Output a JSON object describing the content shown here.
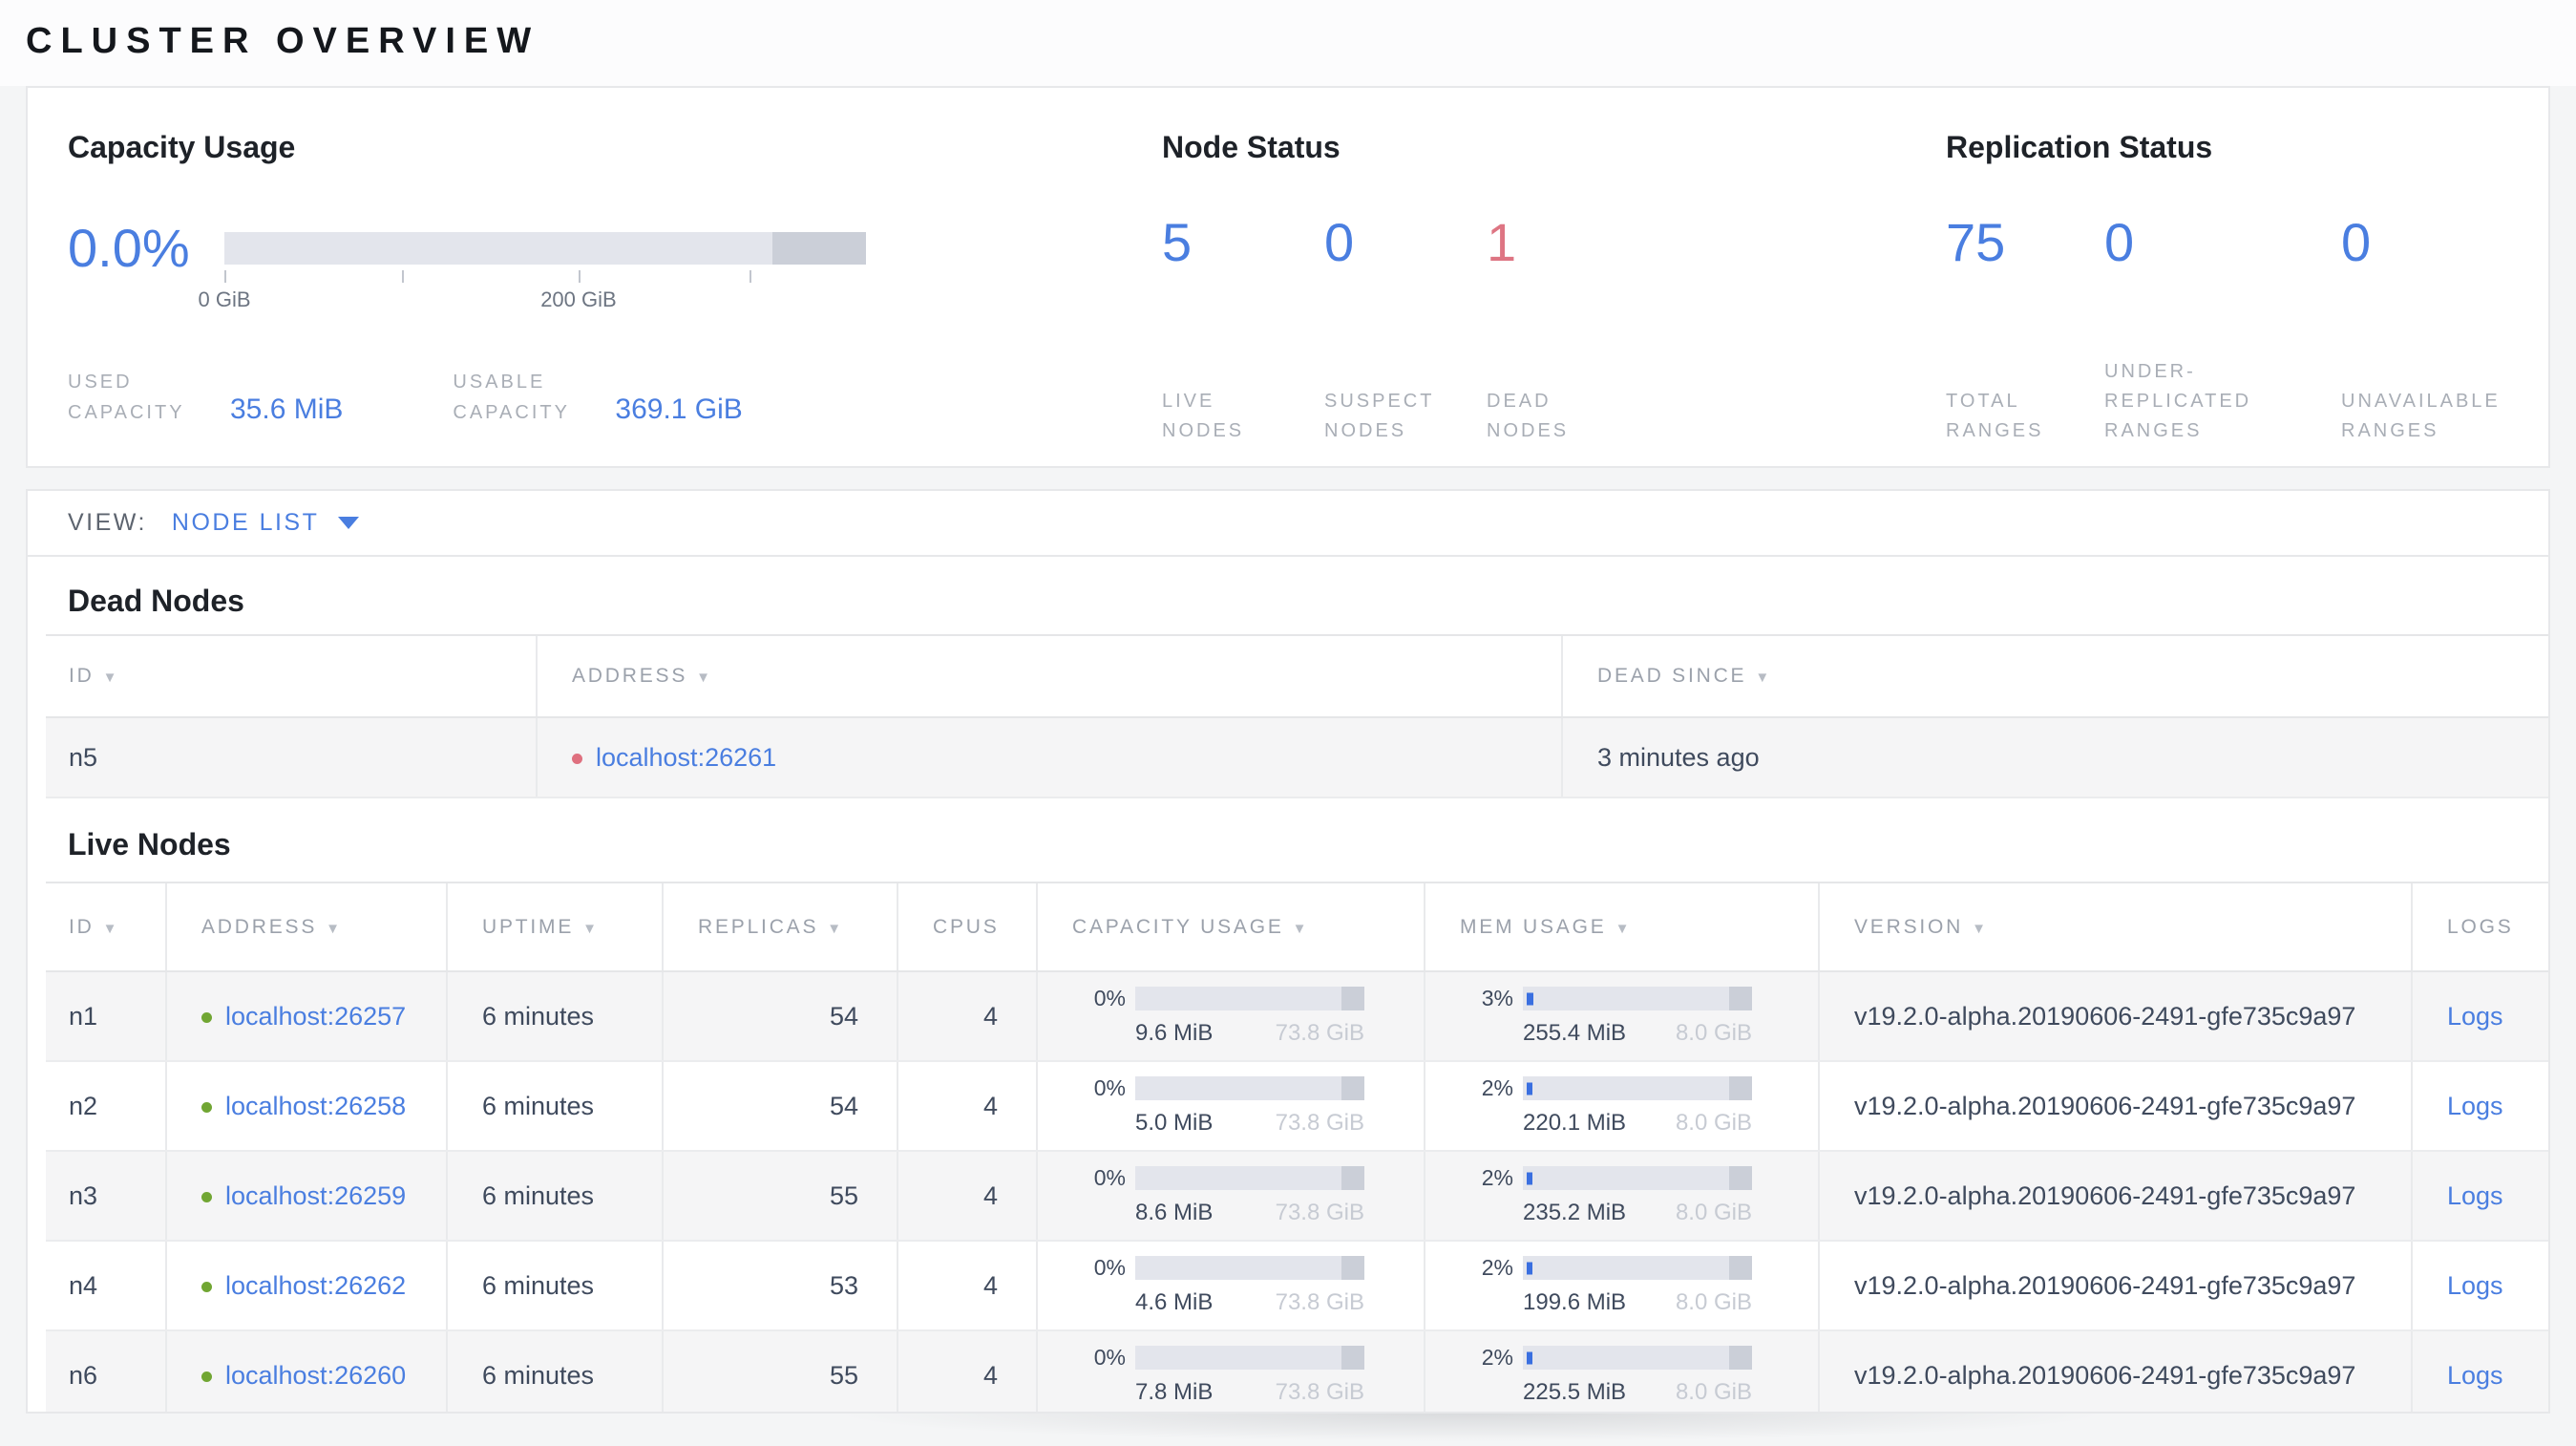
{
  "page_title": "CLUSTER OVERVIEW",
  "colors": {
    "accent_blue": "#4a7ee0",
    "danger_red": "#de7583",
    "live_dot": "#71a633",
    "dead_dot": "#df707f",
    "bar_track": "#e3e5ec",
    "bar_dark": "#cbcfd8"
  },
  "summary": {
    "capacity": {
      "title": "Capacity Usage",
      "percent": "0.0%",
      "tick_labels": {
        "start": "0 GiB",
        "mid": "200 GiB"
      },
      "metrics": [
        {
          "label": "USED CAPACITY",
          "value": "35.6 MiB"
        },
        {
          "label": "USABLE CAPACITY",
          "value": "369.1 GiB"
        }
      ]
    },
    "node_status": {
      "title": "Node Status",
      "stats": [
        {
          "value": "5",
          "label": "LIVE NODES",
          "state": "live"
        },
        {
          "value": "0",
          "label": "SUSPECT NODES",
          "state": "suspect"
        },
        {
          "value": "1",
          "label": "DEAD NODES",
          "state": "dead"
        }
      ]
    },
    "replication_status": {
      "title": "Replication Status",
      "stats": [
        {
          "value": "75",
          "label": "TOTAL RANGES",
          "state": "normal"
        },
        {
          "value": "0",
          "label": "UNDER-REPLICATED RANGES",
          "state": "normal"
        },
        {
          "value": "0",
          "label": "UNAVAILABLE RANGES",
          "state": "normal"
        }
      ]
    }
  },
  "view_bar": {
    "label": "VIEW:",
    "selected": "NODE LIST"
  },
  "dead_nodes": {
    "title": "Dead Nodes",
    "columns": [
      {
        "key": "id",
        "label": "ID",
        "sort": true
      },
      {
        "key": "address",
        "label": "ADDRESS",
        "sort": true
      },
      {
        "key": "dead_since",
        "label": "DEAD SINCE",
        "sort": true
      }
    ],
    "rows": [
      {
        "id": "n5",
        "address": "localhost:26261",
        "status": "dead",
        "dead_since": "3 minutes ago"
      }
    ]
  },
  "live_nodes": {
    "title": "Live Nodes",
    "columns": [
      {
        "key": "id",
        "label": "ID",
        "sort": true
      },
      {
        "key": "address",
        "label": "ADDRESS",
        "sort": true
      },
      {
        "key": "uptime",
        "label": "UPTIME",
        "sort": true
      },
      {
        "key": "replicas",
        "label": "REPLICAS",
        "sort": true
      },
      {
        "key": "cpus",
        "label": "CPUS",
        "sort": false
      },
      {
        "key": "capacity",
        "label": "CAPACITY USAGE",
        "sort": true
      },
      {
        "key": "mem",
        "label": "MEM USAGE",
        "sort": true
      },
      {
        "key": "version",
        "label": "VERSION",
        "sort": true
      },
      {
        "key": "logs",
        "label": "LOGS",
        "sort": false
      }
    ],
    "rows": [
      {
        "id": "n1",
        "address": "localhost:26257",
        "status": "live",
        "uptime": "6 minutes",
        "replicas": "54",
        "cpus": "4",
        "capacity": {
          "pct": "0%",
          "fill": 0,
          "used": "9.6 MiB",
          "total": "73.8 GiB"
        },
        "mem": {
          "pct": "3%",
          "fill": 3,
          "used": "255.4 MiB",
          "total": "8.0 GiB"
        },
        "version": "v19.2.0-alpha.20190606-2491-gfe735c9a97",
        "logs": "Logs"
      },
      {
        "id": "n2",
        "address": "localhost:26258",
        "status": "live",
        "uptime": "6 minutes",
        "replicas": "54",
        "cpus": "4",
        "capacity": {
          "pct": "0%",
          "fill": 0,
          "used": "5.0 MiB",
          "total": "73.8 GiB"
        },
        "mem": {
          "pct": "2%",
          "fill": 2.5,
          "used": "220.1 MiB",
          "total": "8.0 GiB"
        },
        "version": "v19.2.0-alpha.20190606-2491-gfe735c9a97",
        "logs": "Logs"
      },
      {
        "id": "n3",
        "address": "localhost:26259",
        "status": "live",
        "uptime": "6 minutes",
        "replicas": "55",
        "cpus": "4",
        "capacity": {
          "pct": "0%",
          "fill": 0,
          "used": "8.6 MiB",
          "total": "73.8 GiB"
        },
        "mem": {
          "pct": "2%",
          "fill": 2.5,
          "used": "235.2 MiB",
          "total": "8.0 GiB"
        },
        "version": "v19.2.0-alpha.20190606-2491-gfe735c9a97",
        "logs": "Logs"
      },
      {
        "id": "n4",
        "address": "localhost:26262",
        "status": "live",
        "uptime": "6 minutes",
        "replicas": "53",
        "cpus": "4",
        "capacity": {
          "pct": "0%",
          "fill": 0,
          "used": "4.6 MiB",
          "total": "73.8 GiB"
        },
        "mem": {
          "pct": "2%",
          "fill": 2.5,
          "used": "199.6 MiB",
          "total": "8.0 GiB"
        },
        "version": "v19.2.0-alpha.20190606-2491-gfe735c9a97",
        "logs": "Logs"
      },
      {
        "id": "n6",
        "address": "localhost:26260",
        "status": "live",
        "uptime": "6 minutes",
        "replicas": "55",
        "cpus": "4",
        "capacity": {
          "pct": "0%",
          "fill": 0,
          "used": "7.8 MiB",
          "total": "73.8 GiB"
        },
        "mem": {
          "pct": "2%",
          "fill": 2.5,
          "used": "225.5 MiB",
          "total": "8.0 GiB"
        },
        "version": "v19.2.0-alpha.20190606-2491-gfe735c9a97",
        "logs": "Logs"
      }
    ]
  }
}
